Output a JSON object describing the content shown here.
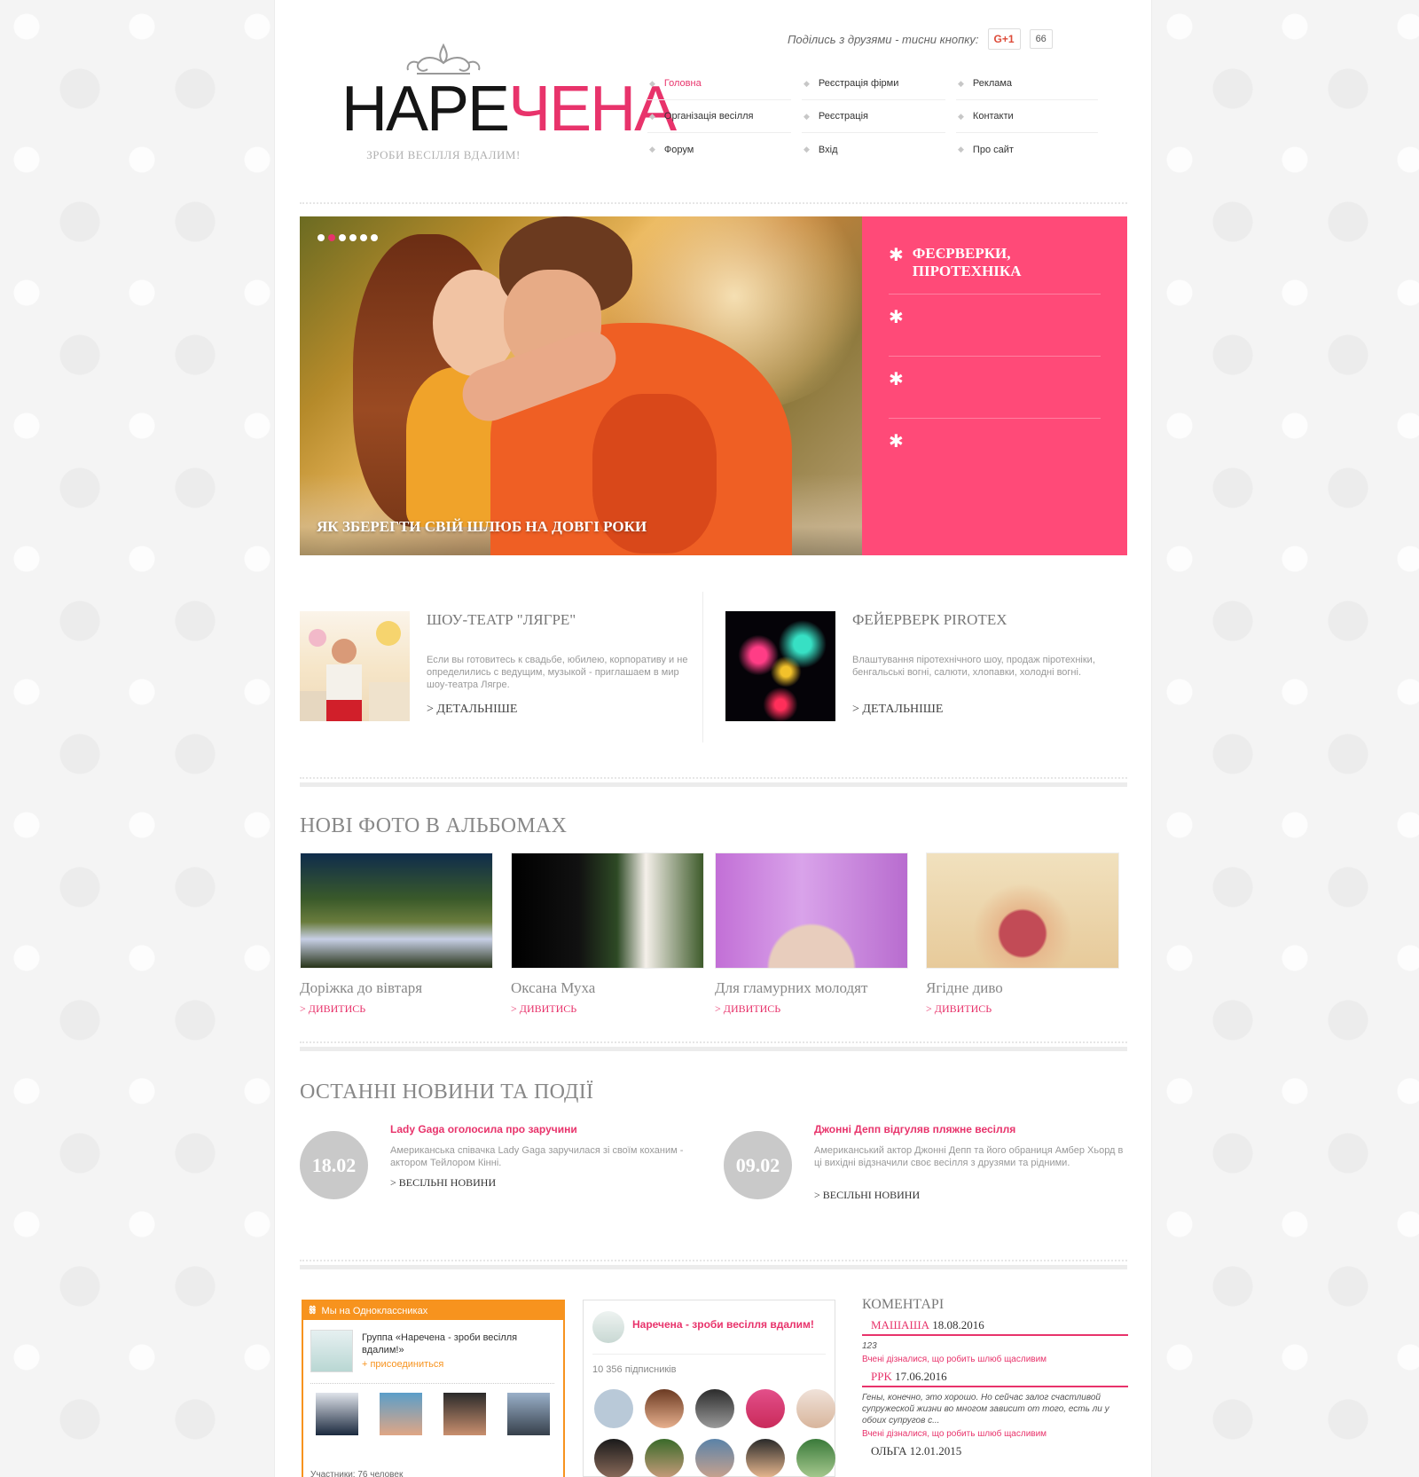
{
  "header": {
    "logo_title_dark": "НАРЕ",
    "logo_title_pink": "ЧЕНА",
    "logo_tagline": "ЗРОБИ ВЕСІЛЛЯ ВДАЛИМ!",
    "share_text": "Поділись з друзями - тисни кнопку:",
    "gplus_label": "G+1",
    "gplus_count": "66"
  },
  "nav": {
    "items": [
      {
        "label": "Головна",
        "active": true
      },
      {
        "label": "Реєстрація фірми"
      },
      {
        "label": "Реклама"
      },
      {
        "label": "Організація весілля"
      },
      {
        "label": "Реєстрація"
      },
      {
        "label": "Контакти"
      },
      {
        "label": "Форум"
      },
      {
        "label": "Вхід"
      },
      {
        "label": "Про сайт"
      }
    ]
  },
  "slider": {
    "dots_count": 6,
    "active_dot": 1,
    "caption": "ЯК ЗБЕРЕГТИ СВІЙ ШЛЮБ НА ДОВГІ РОКИ",
    "panel_items": [
      {
        "label": "ФЕЄРВЕРКИ, ПІРОТЕХНІКА"
      },
      {
        "label": ""
      },
      {
        "label": ""
      },
      {
        "label": ""
      }
    ],
    "star_glyph": "✱"
  },
  "features": [
    {
      "title": "ШОУ-ТЕАТР \"ЛЯГРЕ\"",
      "text": "Если вы готовитесь к свадьбе, юбилею, корпоративу и не определились с ведущим, музыкой - приглашаем в мир шоу-театра Лягре.",
      "more": "> ДЕТАЛЬНІШЕ"
    },
    {
      "title": "ФЕЙЕРВЕРК PIROTEX",
      "text": "Влаштування піротехнічного шоу, продаж піротехніки, бенгальські вогні, салюти, хлопавки, холодні вогні.",
      "more": "> ДЕТАЛЬНІШЕ"
    }
  ],
  "albums": {
    "title": "НОВІ ФОТО В АЛЬБОМАХ",
    "items": [
      {
        "title": "Доріжка до вівтаря",
        "link": "> ДИВИТИСЬ"
      },
      {
        "title": "Оксана Муха",
        "link": "> ДИВИТИСЬ"
      },
      {
        "title": "Для гламурних молодят",
        "link": "> ДИВИТИСЬ"
      },
      {
        "title": "Ягідне диво",
        "link": "> ДИВИТИСЬ"
      }
    ]
  },
  "news": {
    "title": "ОСТАННІ НОВИНИ ТА ПОДІЇ",
    "items": [
      {
        "date": "18.02",
        "title": "Lady Gaga оголосила про заручини",
        "text": "Американська співачка Lady Gaga заручилася зі своїм коханим - актором Тейлором Кінні.",
        "category": "> ВЕСІЛЬНІ НОВИНИ"
      },
      {
        "date": "09.02",
        "title": "Джонні Депп відгуляв пляжне весілля",
        "text": "Американський актор Джонні Депп та його обраниця Амбер Хьорд в ці вихідні відзначили своє весілля з друзями та рідними.",
        "category": "> ВЕСІЛЬНІ НОВИНИ"
      }
    ]
  },
  "ok_widget": {
    "header": "Мы на Одноклассниках",
    "icon": "ok-logo",
    "group_name": "Группа «Наречена - зроби весілля вдалим!»",
    "join": "+ присоединиться",
    "footer": "Участники: 76 человек"
  },
  "vk_widget": {
    "name": "Наречена - зроби весілля вдалим!",
    "subscribers": "10 356 підписників"
  },
  "comments": {
    "title": "КОМЕНТАРІ",
    "items": [
      {
        "author": "МАШАША",
        "date": "18.08.2016",
        "text": "123",
        "link": "Вчені дізналися, що робить шлюб щасливим"
      },
      {
        "author": "PPK",
        "date": "17.06.2016",
        "text": "Гены, конечно, это хорошо. Но сейчас залог счастливой супружеской жизни во многом зависит от того, есть ли у обоих супругов с...",
        "link": "Вчені дізналися, що робить шлюб щасливим"
      },
      {
        "author": "ОЛЬГА",
        "date": "12.01.2015",
        "text": "",
        "link": ""
      }
    ]
  },
  "colors": {
    "accent": "#e8336b",
    "panel_pink": "#ff4a78",
    "ok_orange": "#f7931e",
    "date_circle": "#c9c9c9"
  }
}
